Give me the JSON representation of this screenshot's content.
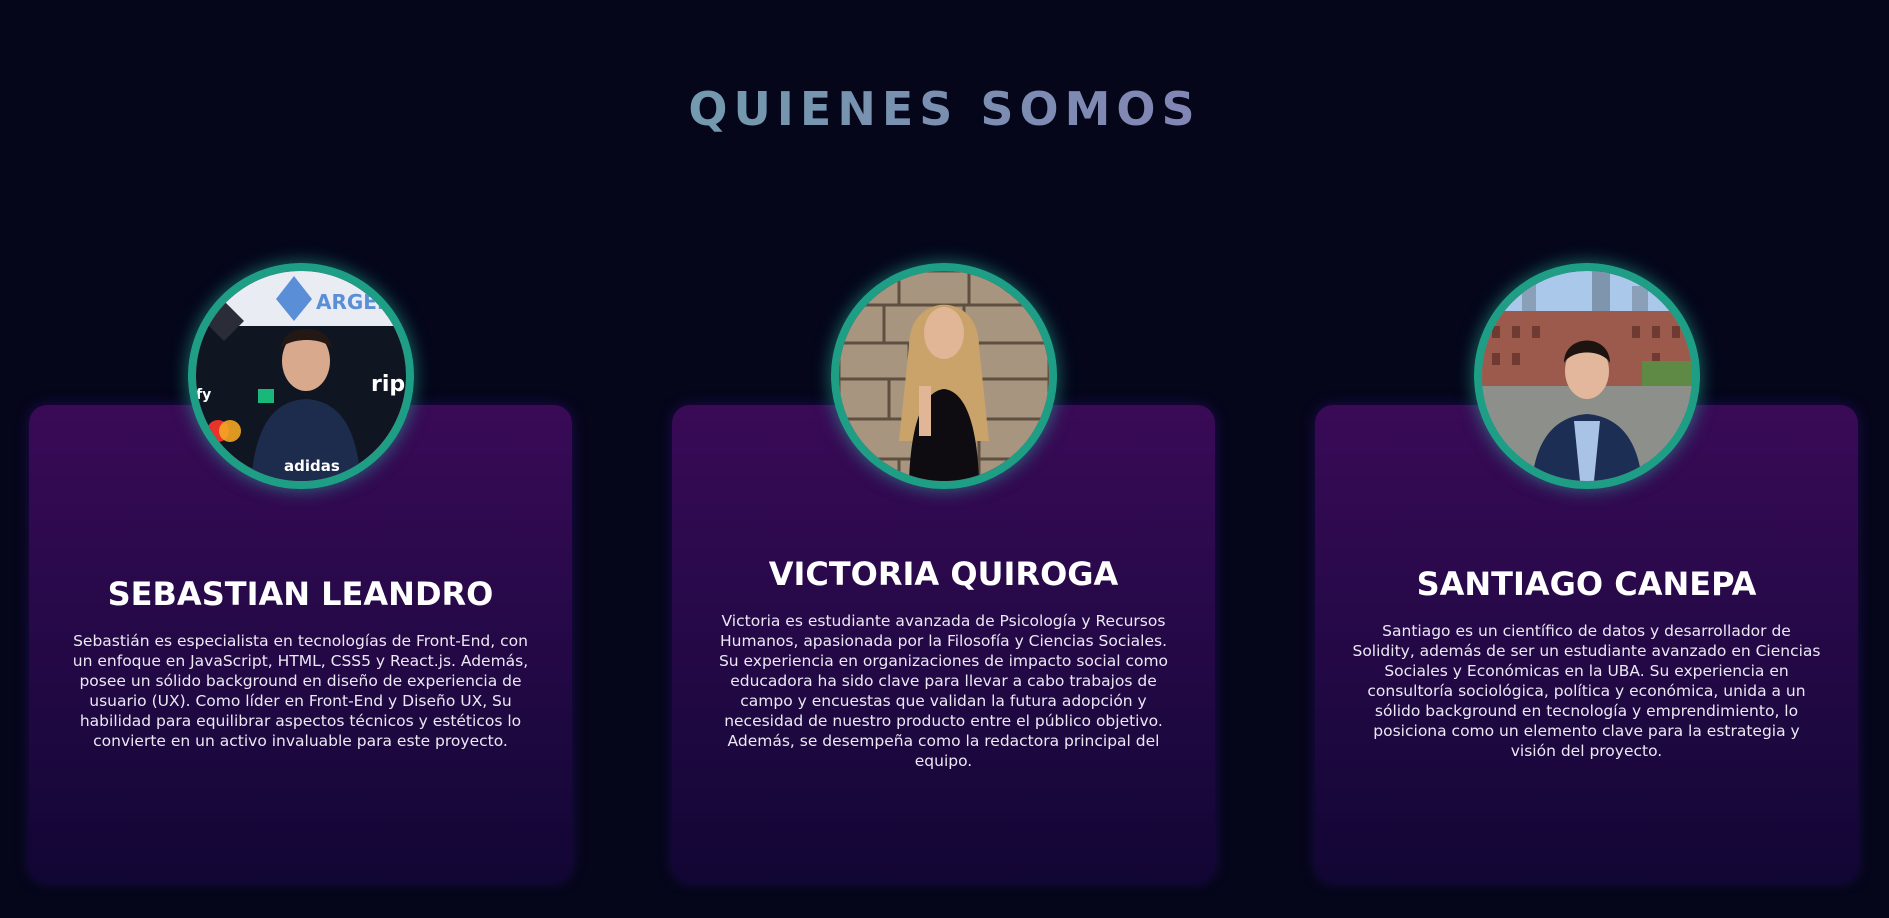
{
  "section": {
    "title": "QUIENES SOMOS"
  },
  "team": [
    {
      "name": "SEBASTIAN LEANDRO",
      "bio": "Sebastián es especialista en tecnologías de Front-End, con un enfoque en JavaScript, HTML, CSS5 y React.js. Además, posee un sólido background en diseño de experiencia de usuario (UX). Como líder en Front-End y Diseño UX, Su habilidad para equilibrar aspectos técnicos y estéticos lo convierte en un activo invaluable para este proyecto.",
      "photo_text": {
        "left_partial": "fy",
        "right_partial": "ripi",
        "banner_partial": "ARGEN",
        "shirt": "adidas"
      }
    },
    {
      "name": "VICTORIA QUIROGA",
      "bio": "Victoria es estudiante avanzada de Psicología y Recursos Humanos, apasionada por la Filosofía y Ciencias Sociales. Su experiencia en organizaciones de impacto social como educadora ha sido clave para llevar a cabo trabajos de campo y encuestas que validan la futura adopción y necesidad de nuestro producto entre el público objetivo. Además, se desempeña como la redactora principal del equipo."
    },
    {
      "name": "SANTIAGO CANEPA",
      "bio": "Santiago es un científico de datos y desarrollador de Solidity, además de ser un estudiante avanzado en Ciencias Sociales y Económicas en la UBA. Su experiencia en consultoría sociológica, política y económica, unida a un sólido background en tecnología y emprendimiento, lo posiciona como un elemento clave para la estrategia y visión del proyecto."
    }
  ],
  "colors": {
    "background": "#05061a",
    "card_top": "#3a0a57",
    "card_bottom": "#120634",
    "ring": "#1f9e86"
  }
}
